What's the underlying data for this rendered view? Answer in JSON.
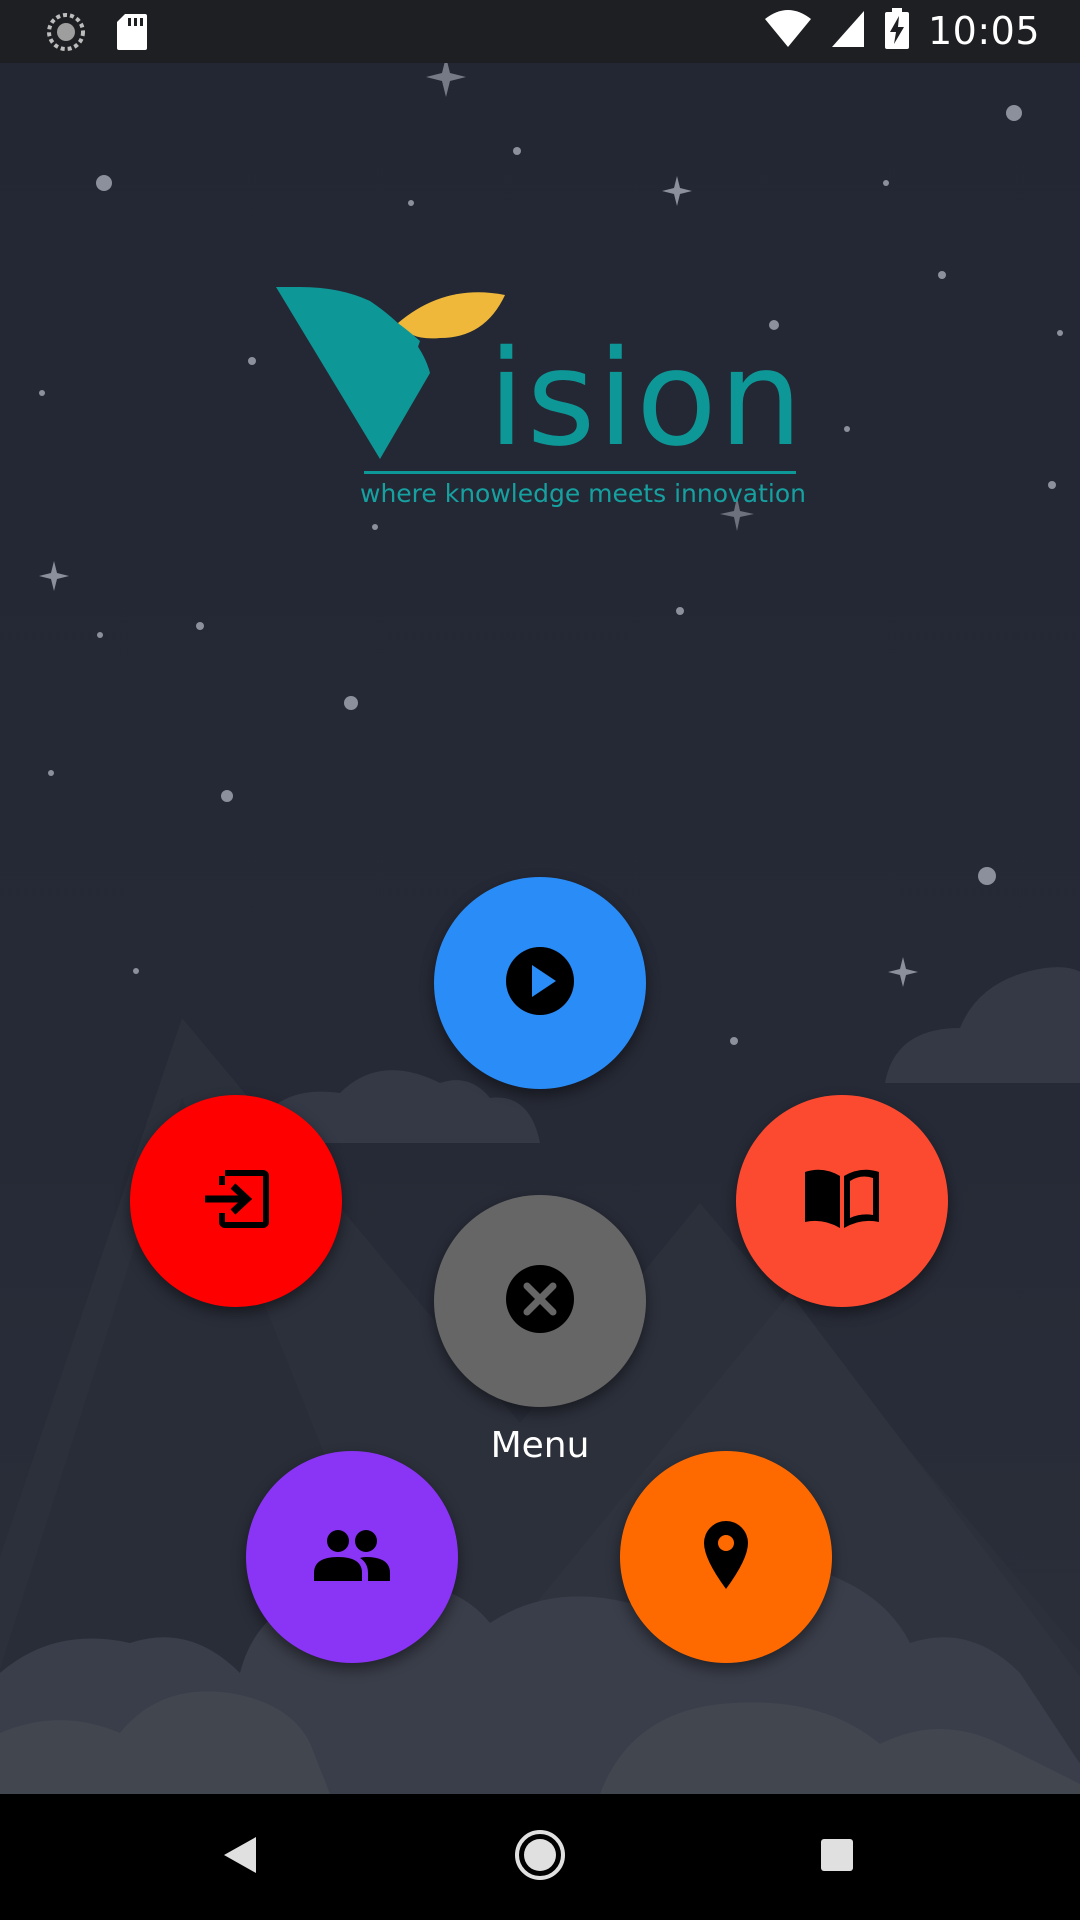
{
  "status_bar": {
    "time": "10:05",
    "icons": [
      "sync-icon",
      "sd-card-icon",
      "wifi-icon",
      "signal-icon",
      "battery-charging-icon"
    ]
  },
  "logo": {
    "wordmark": "ision",
    "tagline": "where knowledge meets innovation",
    "colors": {
      "teal": "#0e9797",
      "gold": "#efb83a"
    }
  },
  "menu": {
    "label": "Menu",
    "buttons": [
      {
        "name": "play-button",
        "icon": "play-icon",
        "color": "#2a8cf7"
      },
      {
        "name": "login-button",
        "icon": "login-icon",
        "color": "#ff0000"
      },
      {
        "name": "book-button",
        "icon": "book-icon",
        "color": "#fc4a30"
      },
      {
        "name": "close-menu-button",
        "icon": "close-icon",
        "color": "#666666"
      },
      {
        "name": "people-button",
        "icon": "people-icon",
        "color": "#8a34f6"
      },
      {
        "name": "location-button",
        "icon": "location-pin-icon",
        "color": "#ff6a00"
      }
    ]
  },
  "nav_bar": {
    "icons": [
      "back-icon",
      "home-icon",
      "recents-icon"
    ]
  }
}
